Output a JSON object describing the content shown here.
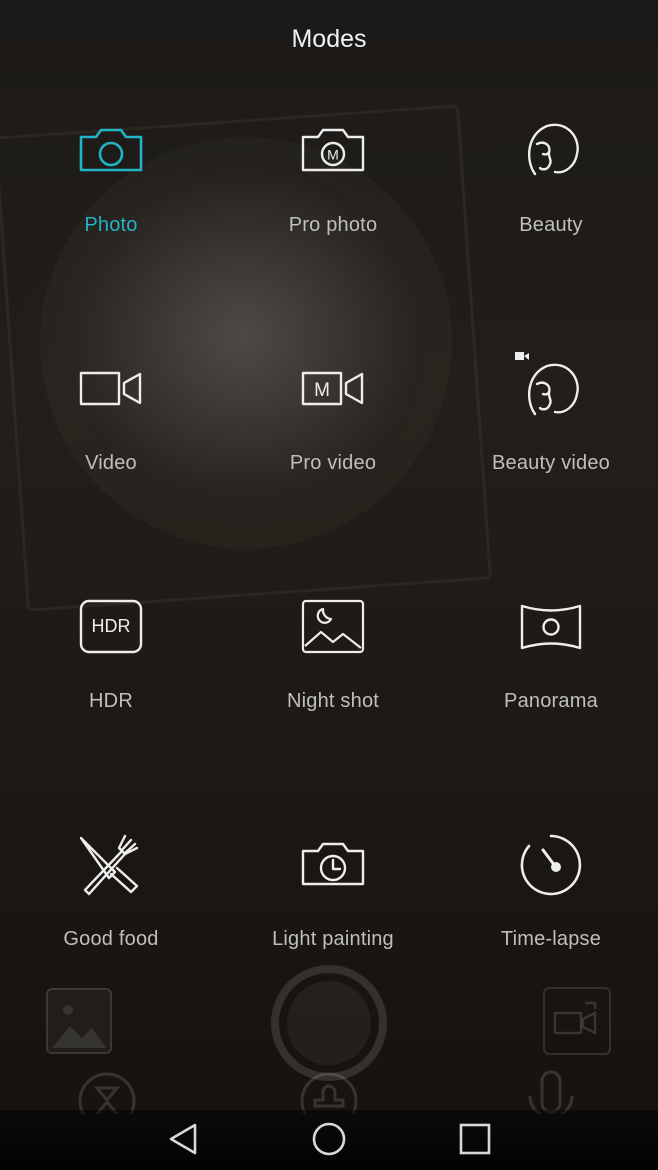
{
  "header": {
    "title": "Modes"
  },
  "modes": [
    {
      "label": "Photo",
      "icon": "camera-icon",
      "active": true
    },
    {
      "label": "Pro photo",
      "icon": "pro-camera-icon"
    },
    {
      "label": "Beauty",
      "icon": "beauty-face-icon"
    },
    {
      "label": "Video",
      "icon": "video-camera-icon"
    },
    {
      "label": "Pro video",
      "icon": "pro-video-icon"
    },
    {
      "label": "Beauty video",
      "icon": "beauty-video-icon"
    },
    {
      "label": "HDR",
      "icon": "hdr-icon"
    },
    {
      "label": "Night shot",
      "icon": "night-shot-icon"
    },
    {
      "label": "Panorama",
      "icon": "panorama-icon"
    },
    {
      "label": "Good food",
      "icon": "fork-knife-icon"
    },
    {
      "label": "Light painting",
      "icon": "light-painting-icon"
    },
    {
      "label": "Time-lapse",
      "icon": "time-lapse-icon"
    }
  ],
  "colors": {
    "accent": "#22b3c6",
    "icon": "#ededed",
    "label": "#bfbfbf"
  },
  "icons": {
    "hdr_text": "HDR",
    "pro_mark": "M"
  },
  "controls": {
    "gallery": "gallery-thumbnail",
    "shutter": "shutter-button",
    "switch": "switch-camera-icon",
    "timer": "timer-icon",
    "beauty_level": "beauty-level-icon",
    "mic": "microphone-icon"
  },
  "navbar": {
    "back": "back-icon",
    "home": "home-icon",
    "recents": "recents-icon"
  }
}
